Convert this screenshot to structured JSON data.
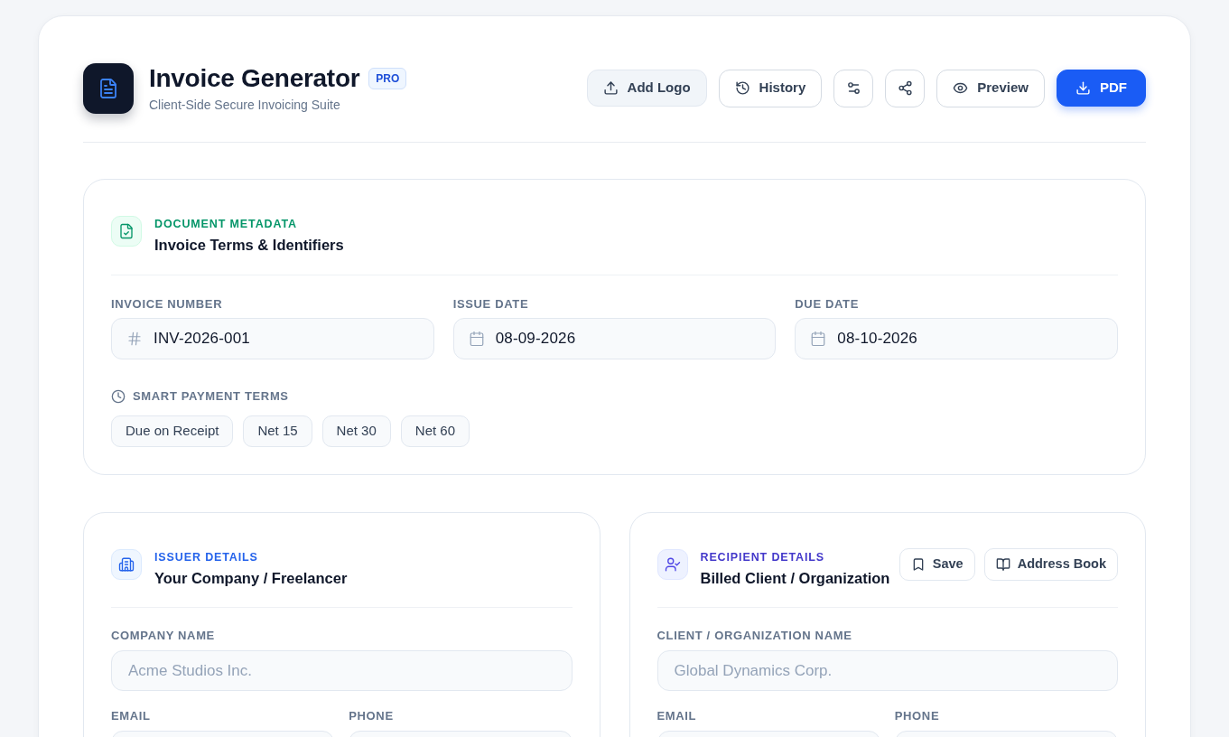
{
  "header": {
    "title": "Invoice Generator",
    "badge": "PRO",
    "subtitle": "Client-Side Secure Invoicing Suite"
  },
  "toolbar": [
    {
      "kind": "soft",
      "label": "Add Logo"
    },
    {
      "kind": "outline",
      "label": "History"
    },
    {
      "kind": "icon"
    },
    {
      "kind": "icon"
    },
    {
      "kind": "outline",
      "label": "Preview"
    },
    {
      "kind": "primary",
      "label": "PDF"
    }
  ],
  "metadata": {
    "eyebrow": "DOCUMENT METADATA",
    "title": "Invoice Terms & Identifiers",
    "fields": [
      {
        "kind": "id",
        "label": "INVOICE NUMBER",
        "value": "INV-2026-001"
      },
      {
        "kind": "date",
        "label": "ISSUE DATE",
        "value": "08-09-2026"
      },
      {
        "kind": "date",
        "label": "DUE DATE",
        "value": "08-10-2026"
      }
    ],
    "terms_label": "SMART PAYMENT TERMS",
    "terms": [
      {
        "label": "Due on Receipt",
        "selected": false
      },
      {
        "label": "Net 15",
        "selected": false
      },
      {
        "label": "Net 30",
        "selected": false
      },
      {
        "label": "Net 60",
        "selected": false
      }
    ]
  },
  "issuer": {
    "eyebrow": "ISSUER DETAILS",
    "title": "Your Company / Freelancer",
    "rows": [
      [
        {
          "label": "COMPANY NAME",
          "placeholder": "Acme Studios Inc."
        }
      ],
      [
        {
          "label": "EMAIL"
        },
        {
          "label": "PHONE"
        }
      ]
    ]
  },
  "recipient": {
    "eyebrow": "RECIPIENT DETAILS",
    "title": "Billed Client / Organization",
    "actions": [
      {
        "label": "Save"
      },
      {
        "label": "Address Book"
      }
    ],
    "rows": [
      [
        {
          "label": "CLIENT / ORGANIZATION NAME",
          "placeholder": "Global Dynamics Corp."
        }
      ],
      [
        {
          "label": "EMAIL"
        },
        {
          "label": "PHONE"
        }
      ]
    ]
  }
}
